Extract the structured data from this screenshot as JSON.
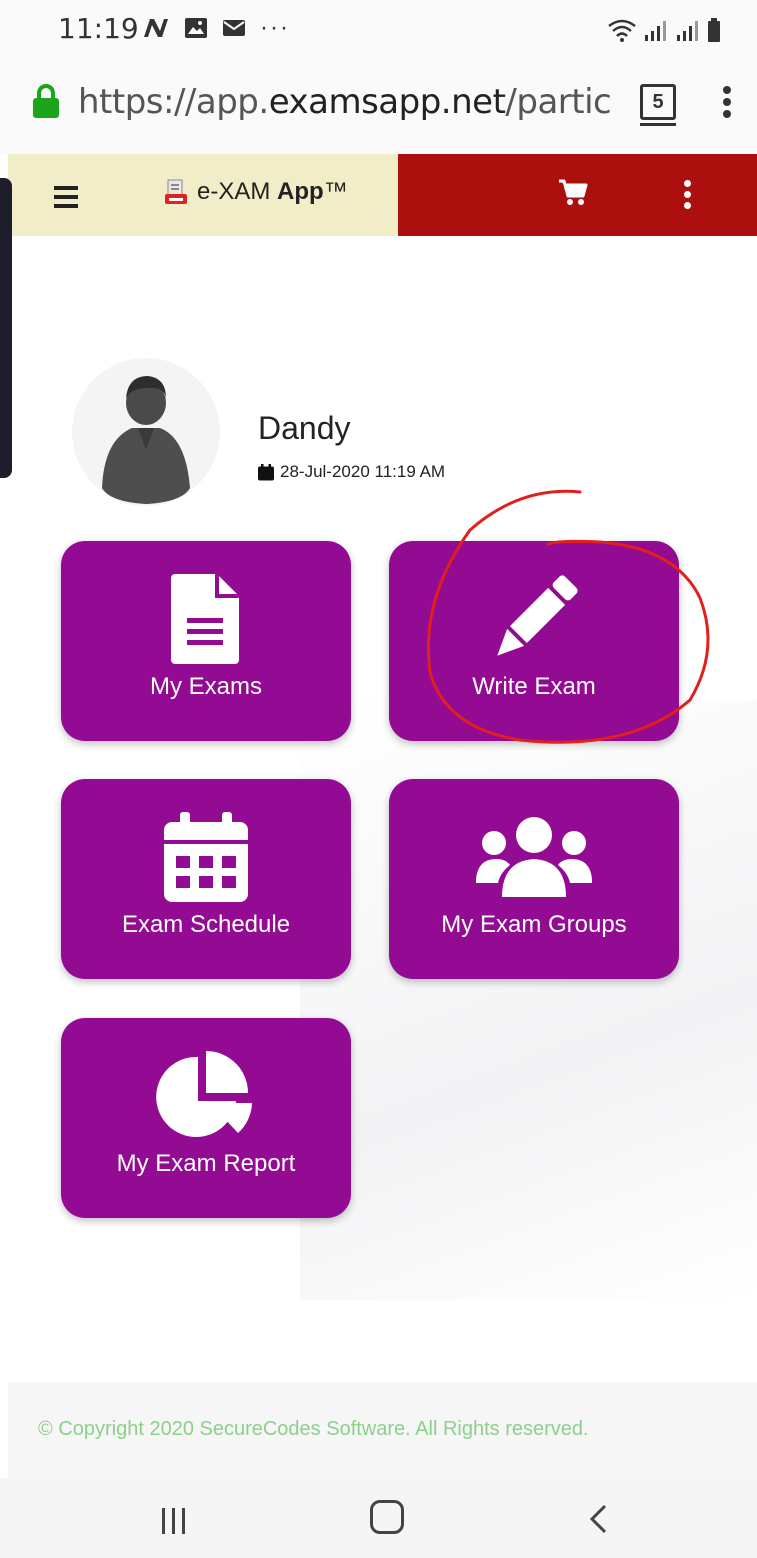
{
  "status_bar": {
    "time": "11:19"
  },
  "browser": {
    "url_prefix": "https://app.",
    "url_domain": "examsapp.net",
    "url_suffix": "/participan",
    "tab_count": "5"
  },
  "app_header": {
    "brand_prefix": "e-XAM ",
    "brand_bold": "App",
    "brand_tm": "™",
    "left_bg": "#f1edc8",
    "right_bg": "#ab0f0e"
  },
  "profile": {
    "name": "Dandy",
    "datetime": "28-Jul-2020 11:19 AM"
  },
  "tiles": [
    {
      "label": "My Exams",
      "icon": "document-icon"
    },
    {
      "label": "Write Exam",
      "icon": "pen-icon"
    },
    {
      "label": "Exam Schedule",
      "icon": "calendar-icon"
    },
    {
      "label": "My Exam Groups",
      "icon": "users-icon"
    },
    {
      "label": "My Exam Report",
      "icon": "pie-chart-icon"
    }
  ],
  "tile_color": "#930a93",
  "footer": {
    "copyright": "© Copyright 2020 SecureCodes Software. All Rights reserved."
  },
  "annotation_color": "#e0201c"
}
